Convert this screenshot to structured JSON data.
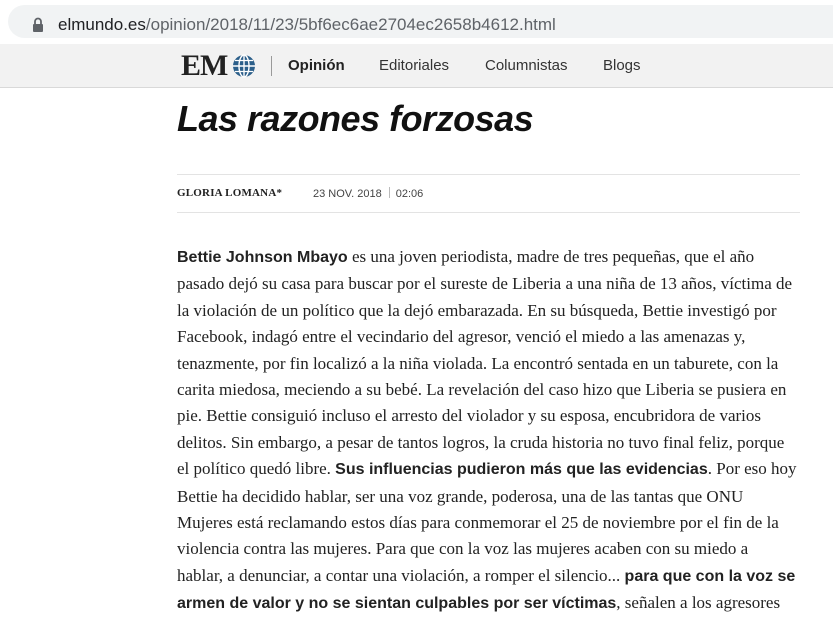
{
  "browser": {
    "url_host": "elmundo.es",
    "url_path": "/opinion/2018/11/23/5bf6ec6ae2704ec2658b4612.html"
  },
  "nav": {
    "logo": "EM",
    "items": [
      "Opinión",
      "Editoriales",
      "Columnistas",
      "Blogs"
    ],
    "active": "Opinión"
  },
  "article": {
    "title": "Las razones forzosas",
    "author": "GLORIA LOMANA*",
    "date": "23 NOV. 2018",
    "time": "02:06",
    "paragraph": [
      {
        "text": "Bettie Johnson Mbayo",
        "bold": true
      },
      {
        "text": " es una joven periodista, madre de tres pequeñas, que el año pasado dejó su casa para buscar por el sureste de Liberia a una niña de 13 años, víctima de la violación de un político que la dejó embarazada. En su búsqueda, Bettie investigó por Facebook, indagó entre el vecindario del agresor, venció el miedo a las amenazas y, tenazmente, por fin localizó a la niña violada. La encontró sentada en un taburete, con la carita miedosa, meciendo a su bebé. La revelación del caso hizo que Liberia se pusiera en pie. Bettie consiguió incluso el arresto del violador y su esposa, encubridora de varios delitos. Sin embargo, a pesar de tantos logros, la cruda historia no tuvo final feliz, porque el político quedó libre. ",
        "bold": false
      },
      {
        "text": "Sus influencias pudieron más que las evidencias",
        "bold": true
      },
      {
        "text": ". Por eso hoy Bettie ha decidido hablar, ser una voz grande, poderosa, una de las tantas que ONU Mujeres está reclamando estos días para conmemorar el 25 de noviembre por el fin de la violencia contra las mujeres. Para que con la voz las mujeres acaben con su miedo a hablar, a denunciar, a contar una violación, a romper el silencio... ",
        "bold": false
      },
      {
        "text": "para que con la voz se armen de valor y no se sientan culpables por ser víctimas",
        "bold": true
      },
      {
        "text": ", señalen a los agresores",
        "bold": false
      }
    ]
  }
}
